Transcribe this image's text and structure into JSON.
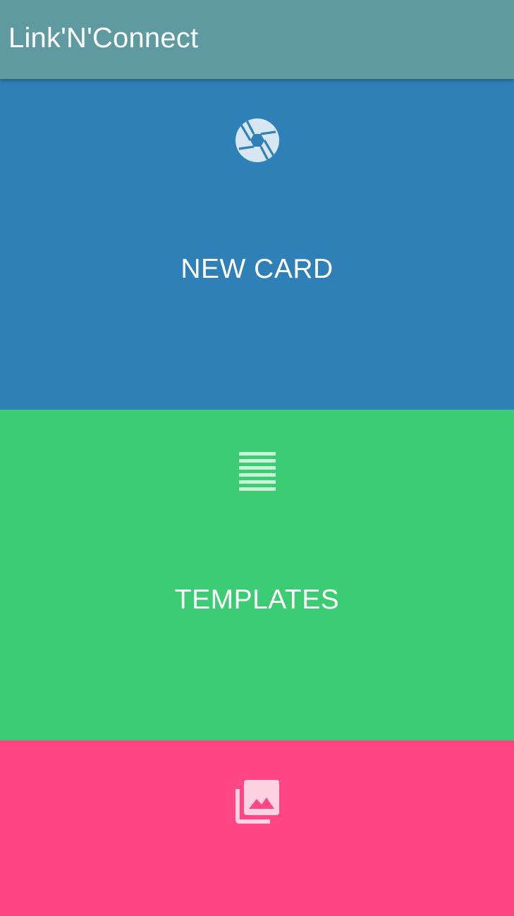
{
  "app_bar": {
    "title": "Link'N'Connect",
    "color": "#5f9aa0"
  },
  "tiles": [
    {
      "label": "NEW CARD",
      "icon": "camera-shutter-icon",
      "color": "#3080b8"
    },
    {
      "label": "TEMPLATES",
      "icon": "list-lines-icon",
      "color": "#3bcc74"
    },
    {
      "label": "",
      "icon": "photo-gallery-icon",
      "color": "#ff4785"
    }
  ]
}
